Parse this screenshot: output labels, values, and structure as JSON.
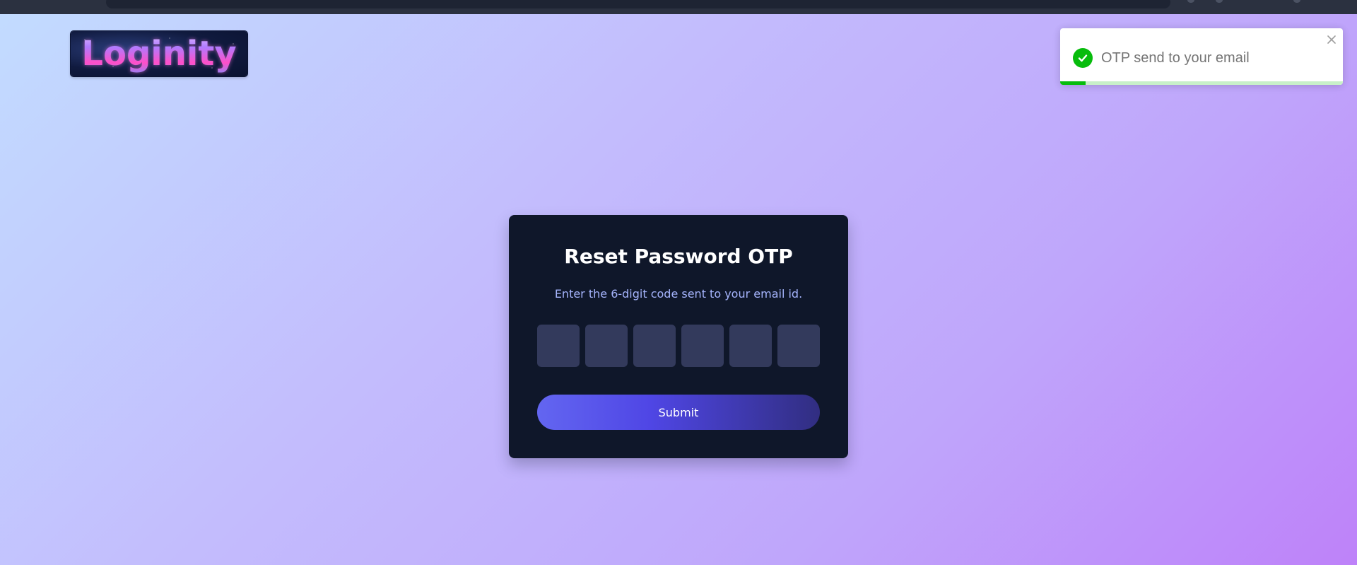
{
  "logo": {
    "text": "Loginity"
  },
  "toast": {
    "message": "OTP send to your email",
    "progress_fraction": 0.09,
    "success_color": "#07bc0c"
  },
  "card": {
    "title": "Reset Password OTP",
    "subtitle": "Enter the 6-digit code sent to your email id.",
    "otp_digits": [
      "",
      "",
      "",
      "",
      "",
      ""
    ],
    "submit_label": "Submit"
  },
  "colors": {
    "card_bg": "#0f172a",
    "accent": "#6366f1",
    "subtitle": "#a5b4fc",
    "otp_box": "#333a5c"
  },
  "icons": {
    "toast_status": "check-circle-icon",
    "toast_close": "close-icon"
  }
}
